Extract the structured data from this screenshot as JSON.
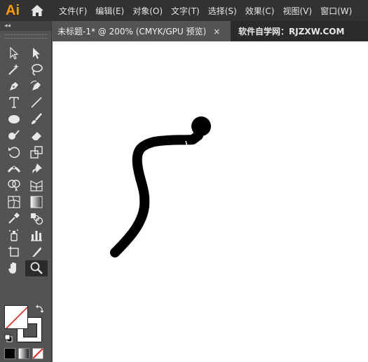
{
  "app": {
    "logo": "Ai",
    "home_icon": "home-icon"
  },
  "menu": {
    "items": [
      "文件(F)",
      "编辑(E)",
      "对象(O)",
      "文字(T)",
      "选择(S)",
      "效果(C)",
      "视图(V)",
      "窗口(W)"
    ]
  },
  "tabs": {
    "document_title": "未标题-1* @ 200% (CMYK/GPU 预览)",
    "close_glyph": "×",
    "watermark": "软件自学网：RJZXW.COM"
  },
  "toolbar": {
    "collapse_glyph": "◂◂",
    "tools": [
      [
        "selection-tool",
        "direct-selection-tool"
      ],
      [
        "magic-wand-tool",
        "lasso-tool"
      ],
      [
        "pen-tool",
        "curvature-tool"
      ],
      [
        "type-tool",
        "line-segment-tool"
      ],
      [
        "ellipse-tool",
        "paintbrush-tool"
      ],
      [
        "shaper-tool",
        "eraser-tool"
      ],
      [
        "rotate-tool",
        "scale-tool"
      ],
      [
        "width-tool",
        "puppet-warp-tool"
      ],
      [
        "shape-builder-tool",
        "perspective-grid-tool"
      ],
      [
        "mesh-tool",
        "gradient-tool"
      ],
      [
        "eyedropper-tool",
        "blend-tool"
      ],
      [
        "symbol-sprayer-tool",
        "column-graph-tool"
      ],
      [
        "artboard-tool",
        "slice-tool"
      ],
      [
        "hand-tool",
        "zoom-tool"
      ]
    ],
    "selected_tool": "zoom-tool",
    "fill_color": "#ffffff",
    "stroke_color": "#000000"
  },
  "canvas": {
    "background": "#ffffff",
    "stroke_color": "#000000"
  }
}
